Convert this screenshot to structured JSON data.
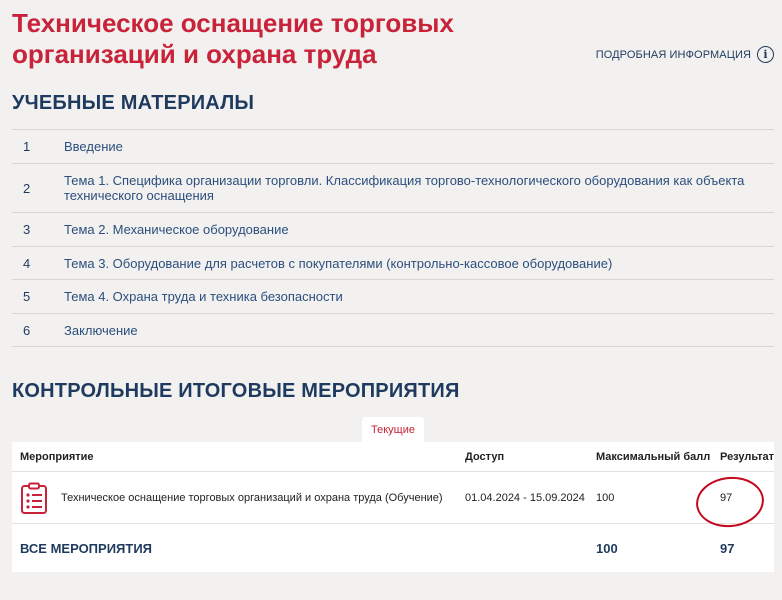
{
  "page": {
    "title": "Техническое оснащение торговых организаций и охрана труда",
    "more_info_label": "ПОДРОБНАЯ ИНФОРМАЦИЯ",
    "info_icon_glyph": "i"
  },
  "materials": {
    "heading": "УЧЕБНЫЕ МАТЕРИАЛЫ",
    "items": [
      {
        "num": "1",
        "label": "Введение"
      },
      {
        "num": "2",
        "label": "Тема 1. Специфика организации торговли. Классификация торгово-технологического оборудования как объекта технического оснащения"
      },
      {
        "num": "3",
        "label": "Тема 2. Механическое оборудование"
      },
      {
        "num": "4",
        "label": "Тема 3. Оборудование для расчетов с покупателями (контрольно-кассовое оборудование)"
      },
      {
        "num": "5",
        "label": "Тема 4. Охрана труда и техника безопасности"
      },
      {
        "num": "6",
        "label": "Заключение"
      }
    ]
  },
  "control": {
    "heading": "КОНТРОЛЬНЫЕ ИТОГОВЫЕ МЕРОПРИЯТИЯ",
    "tab_current": "Текущие",
    "columns": {
      "event": "Мероприятие",
      "access": "Доступ",
      "max_score": "Максимальный балл",
      "result": "Результат"
    },
    "rows": [
      {
        "icon": "clipboard-icon",
        "name": "Техническое оснащение торговых организаций и охрана труда (Обучение)",
        "access": "01.04.2024 - 15.09.2024",
        "max_score": "100",
        "result": "97"
      }
    ],
    "total": {
      "label": "ВСЕ МЕРОПРИЯТИЯ",
      "max_score": "100",
      "result": "97"
    }
  },
  "colors": {
    "accent": "#c8233a",
    "text": "#1e3a5f",
    "background": "#f3f1ef",
    "annotation": "#c2091d"
  }
}
